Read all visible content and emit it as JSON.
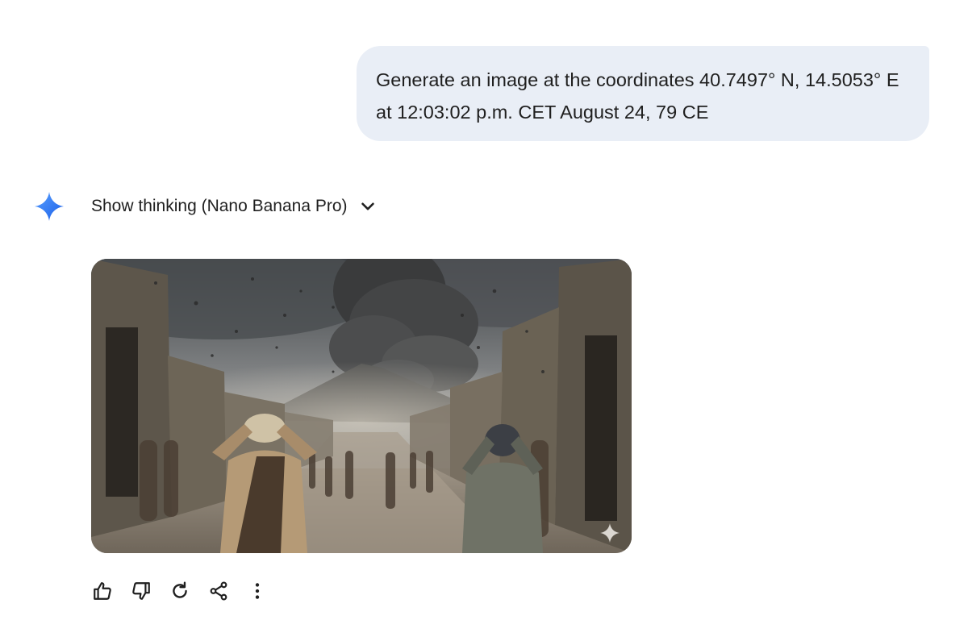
{
  "conversation": {
    "user_prompt": {
      "lines": [
        "Generate an image at the coordinates 40.7497° N, 14.5053° E",
        "at 12:03:02 p.m. CET August 24, 79 CE"
      ]
    },
    "response": {
      "assistant_icon": "gemini-spark-icon",
      "thinking_toggle_label": "Show thinking (Nano Banana Pro)",
      "thinking_toggle_icon": "chevron-down-icon",
      "image": {
        "content": "ancient-street-eruption-scene",
        "badge_icon": "spark-watermark-icon"
      },
      "actions": [
        {
          "name": "thumbs-up",
          "icon": "thumbs-up-icon"
        },
        {
          "name": "thumbs-down",
          "icon": "thumbs-down-icon"
        },
        {
          "name": "redo",
          "icon": "refresh-icon"
        },
        {
          "name": "share",
          "icon": "share-icon"
        },
        {
          "name": "more-options",
          "icon": "more-vert-icon"
        }
      ]
    }
  },
  "colors": {
    "bubble_bg": "#e9eef6",
    "text": "#1f1f1f",
    "spark_start": "#4b90ff",
    "spark_end": "#1a5fe8"
  }
}
